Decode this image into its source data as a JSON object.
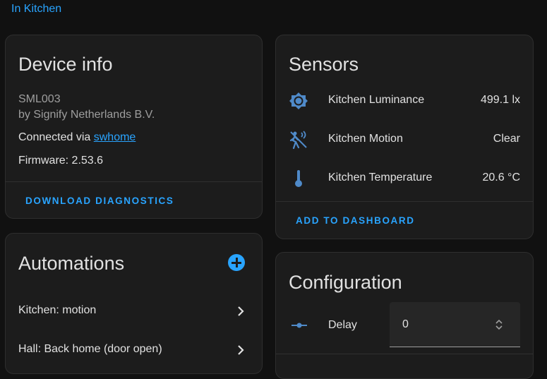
{
  "breadcrumb": {
    "area": "In Kitchen"
  },
  "device_info": {
    "title": "Device info",
    "model": "SML003",
    "manufacturer": "by Signify Netherlands B.V.",
    "connected_prefix": "Connected via ",
    "connected_link": "swhome",
    "firmware": "Firmware: 2.53.6",
    "action": "DOWNLOAD DIAGNOSTICS"
  },
  "sensors": {
    "title": "Sensors",
    "items": [
      {
        "name": "Kitchen Luminance",
        "value": "499.1 lx",
        "icon": "brightness-icon"
      },
      {
        "name": "Kitchen Motion",
        "value": "Clear",
        "icon": "motion-sensor-icon"
      },
      {
        "name": "Kitchen Temperature",
        "value": "20.6 °C",
        "icon": "thermometer-icon"
      }
    ],
    "action": "ADD TO DASHBOARD"
  },
  "automations": {
    "title": "Automations",
    "items": [
      {
        "label": "Kitchen: motion"
      },
      {
        "label": "Hall: Back home (door open)"
      }
    ]
  },
  "configuration": {
    "title": "Configuration",
    "delay_label": "Delay",
    "delay_value": "0"
  },
  "colors": {
    "accent": "#29a4ff",
    "icon": "#4f8ac9",
    "card_bg": "#1c1c1c",
    "page_bg": "#111111"
  }
}
